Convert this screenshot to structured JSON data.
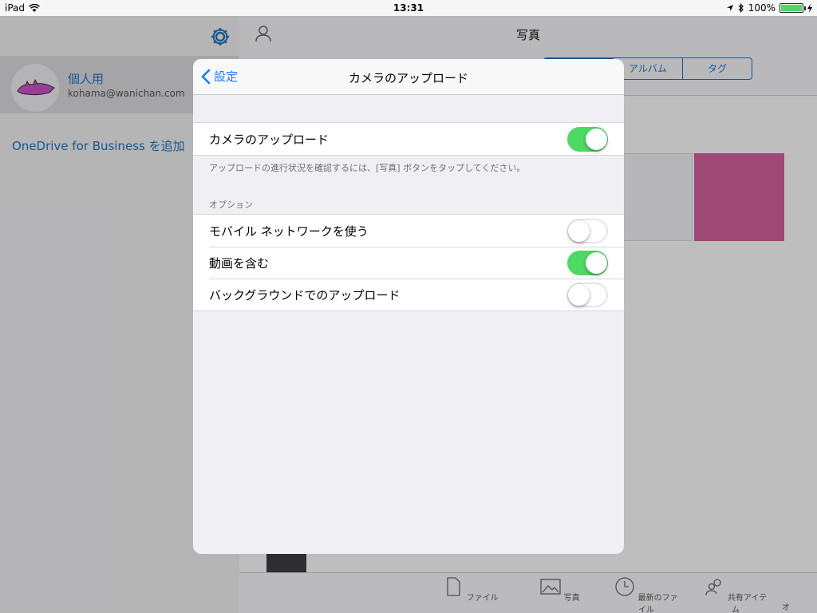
{
  "status_bar": {
    "device": "iPad",
    "time": "13:31",
    "battery": "100%"
  },
  "sidebar": {
    "account_name": "個人用",
    "account_email": "kohama@wanichan.com",
    "add_business": "OneDrive for Business を追加"
  },
  "main": {
    "title": "写真",
    "segments": [
      "",
      "アルバム",
      "タグ"
    ],
    "tabs": [
      "ファイル",
      "写真",
      "最新のファイル",
      "共有アイテム",
      "オ"
    ]
  },
  "modal": {
    "back_label": "設定",
    "title": "カメラのアップロード",
    "camera_upload_label": "カメラのアップロード",
    "camera_upload_on": true,
    "note": "アップロードの進行状況を確認するには、[写真] ボタンをタップしてください。",
    "options_header": "オプション",
    "options": [
      {
        "label": "モバイル ネットワークを使う",
        "on": false
      },
      {
        "label": "動画を含む",
        "on": true
      },
      {
        "label": "バックグラウンドでのアップロード",
        "on": false
      }
    ]
  },
  "colors": {
    "accent": "#147efb",
    "link": "#2171b8",
    "toggle_on": "#4cd964",
    "toggle_off": "#e5e5ea"
  }
}
